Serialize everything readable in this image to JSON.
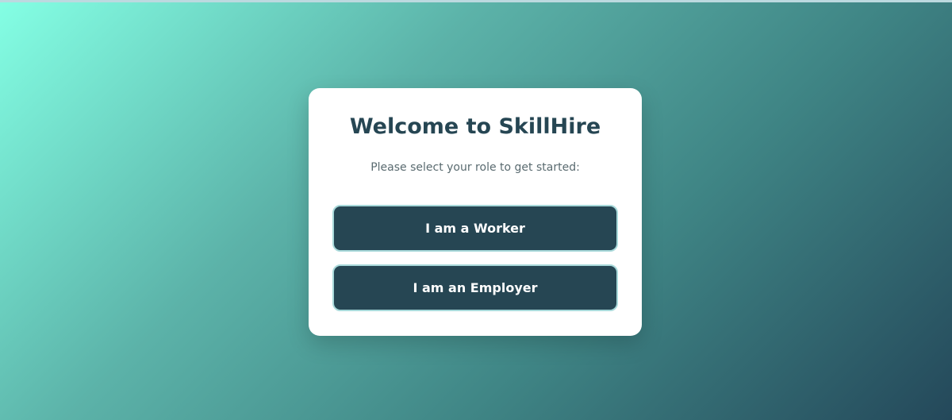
{
  "page": {
    "title": "Welcome to SkillHire",
    "subtitle": "Please select your role to get started:"
  },
  "roles": {
    "worker_label": "I am a Worker",
    "employer_label": "I am an Employer"
  },
  "colors": {
    "primary": "#264653",
    "gradient_start": "#84ffe4",
    "gradient_end": "#24485a",
    "button_border": "#a8d9da"
  }
}
